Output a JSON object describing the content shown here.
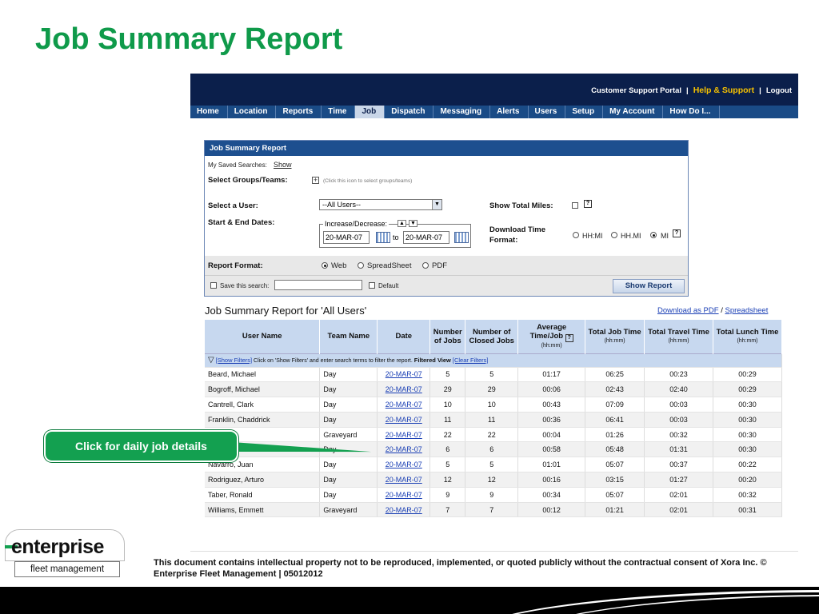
{
  "slide": {
    "title": "Job Summary Report",
    "callout": "Click for daily job details",
    "footer": "This document contains intellectual property not to be reproduced, implemented, or quoted publicly without the contractual consent of Xora Inc. © Enterprise Fleet Management | 05012012",
    "logo_word": "enterprise",
    "logo_sub": "fleet management"
  },
  "header": {
    "links": [
      "Customer Support Portal",
      "Help & Support",
      "Logout"
    ]
  },
  "nav": [
    "Home",
    "Location",
    "Reports",
    "Time",
    "Job",
    "Dispatch",
    "Messaging",
    "Alerts",
    "Users",
    "Setup",
    "My Account",
    "How Do I..."
  ],
  "nav_active": "Job",
  "form": {
    "panel_title": "Job Summary Report",
    "saved_searches_label": "My Saved Searches:",
    "saved_searches_link": "Show",
    "groups_label": "Select Groups/Teams:",
    "groups_hint": "(Click this icon to select groups/teams)",
    "user_label": "Select a User:",
    "user_value": "--All Users--",
    "dates_label": "Start & End Dates:",
    "incdec_label": "Increase/Decrease:",
    "start_date": "20-MAR-07",
    "to_label": "to",
    "end_date": "20-MAR-07",
    "total_miles_label": "Show Total Miles:",
    "download_label_1": "Download Time",
    "download_label_2": "Format:",
    "time_formats": [
      "HH:MI",
      "HH.MI",
      "MI"
    ],
    "time_format_selected": "MI",
    "report_format_label": "Report Format:",
    "report_formats": [
      "Web",
      "SpreadSheet",
      "PDF"
    ],
    "report_format_selected": "Web",
    "save_search_label": "Save this search:",
    "default_label": "Default",
    "show_report_button": "Show Report"
  },
  "results": {
    "title": "Job Summary Report for 'All Users'",
    "download_pdf": "Download as PDF",
    "slash": "/",
    "spreadsheet": "Spreadsheet",
    "columns": [
      {
        "label": "User Name",
        "unit": ""
      },
      {
        "label": "Team Name",
        "unit": ""
      },
      {
        "label": "Date",
        "unit": ""
      },
      {
        "label": "Number of Jobs",
        "unit": ""
      },
      {
        "label": "Number of Closed Jobs",
        "unit": ""
      },
      {
        "label": "Average Time/Job",
        "unit": "(hh:mm)"
      },
      {
        "label": "Total Job Time",
        "unit": "(hh:mm)"
      },
      {
        "label": "Total Travel Time",
        "unit": "(hh:mm)"
      },
      {
        "label": "Total Lunch Time",
        "unit": "(hh:mm)"
      }
    ],
    "filter_link": "[Show Filters]",
    "filter_text": "Click on 'Show Filters' and enter search terms to filter the report.",
    "filtered_view": "Filtered View",
    "clear_filters": "[Clear Filters]",
    "rows": [
      [
        "Beard, Michael",
        "Day",
        "20-MAR-07",
        "5",
        "5",
        "01:17",
        "06:25",
        "00:23",
        "00:29"
      ],
      [
        "Bogroff, Michael",
        "Day",
        "20-MAR-07",
        "29",
        "29",
        "00:06",
        "02:43",
        "02:40",
        "00:29"
      ],
      [
        "Cantrell, Clark",
        "Day",
        "20-MAR-07",
        "10",
        "10",
        "00:43",
        "07:09",
        "00:03",
        "00:30"
      ],
      [
        "Franklin, Chaddrick",
        "Day",
        "20-MAR-07",
        "11",
        "11",
        "00:36",
        "06:41",
        "00:03",
        "00:30"
      ],
      [
        "owell",
        "Graveyard",
        "20-MAR-07",
        "22",
        "22",
        "00:04",
        "01:26",
        "00:32",
        "00:30"
      ],
      [
        "",
        "Day",
        "20-MAR-07",
        "6",
        "6",
        "00:58",
        "05:48",
        "01:31",
        "00:30"
      ],
      [
        "Navarro, Juan",
        "Day",
        "20-MAR-07",
        "5",
        "5",
        "01:01",
        "05:07",
        "00:37",
        "00:22"
      ],
      [
        "Rodriguez, Arturo",
        "Day",
        "20-MAR-07",
        "12",
        "12",
        "00:16",
        "03:15",
        "01:27",
        "00:20"
      ],
      [
        "Taber, Ronald",
        "Day",
        "20-MAR-07",
        "9",
        "9",
        "00:34",
        "05:07",
        "02:01",
        "00:32"
      ],
      [
        "Williams, Emmett",
        "Graveyard",
        "20-MAR-07",
        "7",
        "7",
        "00:12",
        "01:21",
        "02:01",
        "00:31"
      ]
    ]
  },
  "colors": {
    "title_green": "#0f9a4a",
    "header_navy": "#0b1f4b",
    "nav_blue": "#1a4b86",
    "accent_yellow": "#f7c200",
    "table_header": "#c7d8ef"
  }
}
